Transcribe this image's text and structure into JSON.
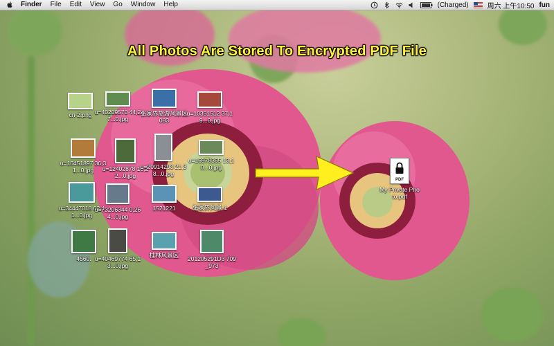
{
  "menubar": {
    "app_name": "Finder",
    "items": [
      "File",
      "Edit",
      "View",
      "Go",
      "Window",
      "Help"
    ],
    "battery_status": "(Charged)",
    "date_time": "周六 上午10:50",
    "user": "fun"
  },
  "headline": "All Photos Are Stored To Encrypted PDF File",
  "files": [
    {
      "name": "cn-2.png",
      "color": "#b7d38a"
    },
    {
      "name": "u=40209570 44,27...0.jpg",
      "color": "#5f8c4f"
    },
    {
      "name": "张家界旅游风景区083",
      "color": "#3b6fa8"
    },
    {
      "name": "u=10351512 37,19...0.jpg",
      "color": "#a54a3a"
    },
    {
      "name": "u=16451897 36,31...0.jpg",
      "color": "#b27a3b"
    },
    {
      "name": "u=12402878 16,22...0.jpg",
      "color": "#4d6b3a"
    },
    {
      "name": "u=20914293 21,38...0.jpg",
      "color": "#8a8f96"
    },
    {
      "name": "u=16978365 13,10...0.jpg",
      "color": "#6a8a5a"
    },
    {
      "name": "u=34447018 62,41...0.jpg",
      "color": "#4a9a9c"
    },
    {
      "name": "u=73206344 0,264...0.jpg",
      "color": "#667a8c"
    },
    {
      "name": "1521221",
      "color": "#5a93b5"
    },
    {
      "name": "张家界风景-1",
      "color": "#3c5a8f"
    },
    {
      "name": "4560.",
      "color": "#3f7a45"
    },
    {
      "name": "u=40469774 65,13...0.jpg",
      "color": "#4b4b46"
    },
    {
      "name": "桂林风景区",
      "color": "#5aa1b0"
    },
    {
      "name": "201205291D3 709_973",
      "color": "#4e8a6a"
    }
  ],
  "pdf_file": {
    "icon_label": "PDF",
    "name": "My Private Photo.pdf"
  },
  "colors": {
    "headline": "#fff43a",
    "arrow": "#ffef1f"
  }
}
